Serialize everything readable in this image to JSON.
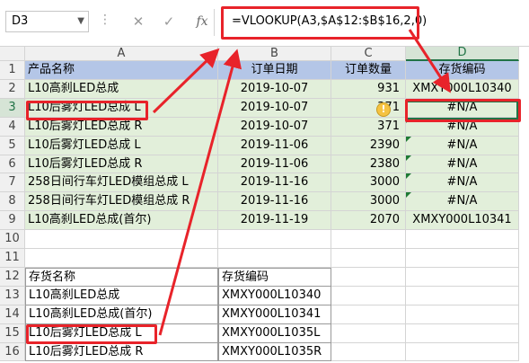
{
  "formula_bar": {
    "name_box": "D3",
    "cancel_icon": "✕",
    "enter_icon": "✓",
    "fx_label": "fx",
    "formula": "=VLOOKUP(A3,$A$12:$B$16,2,0)"
  },
  "columns": [
    "A",
    "B",
    "C",
    "D"
  ],
  "row_numbers": [
    "1",
    "2",
    "3",
    "4",
    "5",
    "6",
    "7",
    "8",
    "9",
    "10",
    "11",
    "12",
    "13",
    "14",
    "15",
    "16"
  ],
  "main_table": {
    "headers": [
      "产品名称",
      "订单日期",
      "订单数量",
      "存货编码"
    ],
    "rows": [
      [
        "L10高刹LED总成",
        "2019-10-07",
        "931",
        "XMXY000L10340"
      ],
      [
        "L10后雾灯LED总成 L",
        "2019-10-07",
        "371",
        "#N/A"
      ],
      [
        "L10后雾灯LED总成 R",
        "2019-10-07",
        "371",
        "#N/A"
      ],
      [
        "L10后雾灯LED总成 L",
        "2019-11-06",
        "2390",
        "#N/A"
      ],
      [
        "L10后雾灯LED总成 R",
        "2019-11-06",
        "2380",
        "#N/A"
      ],
      [
        "258日间行车灯LED模组总成 L",
        "2019-11-16",
        "3000",
        "#N/A"
      ],
      [
        "258日间行车灯LED模组总成 R",
        "2019-11-16",
        "3000",
        "#N/A"
      ],
      [
        "L10高刹LED总成(首尔)",
        "2019-11-19",
        "2070",
        "XMXY000L10341"
      ]
    ]
  },
  "lookup_table": {
    "headers": [
      "存货名称",
      "存货编码"
    ],
    "rows": [
      [
        "L10高刹LED总成",
        "XMXY000L10340"
      ],
      [
        "L10高刹LED总成(首尔)",
        "XMXY000L10341"
      ],
      [
        "L10后雾灯LED总成 L ",
        "XMXY000L1035L"
      ],
      [
        "L10后雾灯LED总成 R",
        "XMXY000L1035R"
      ]
    ]
  },
  "colors": {
    "header_fill": "#b4c6e7",
    "data_fill": "#e2efda",
    "annotation_red": "#e8232a",
    "selection_green": "#217346"
  }
}
